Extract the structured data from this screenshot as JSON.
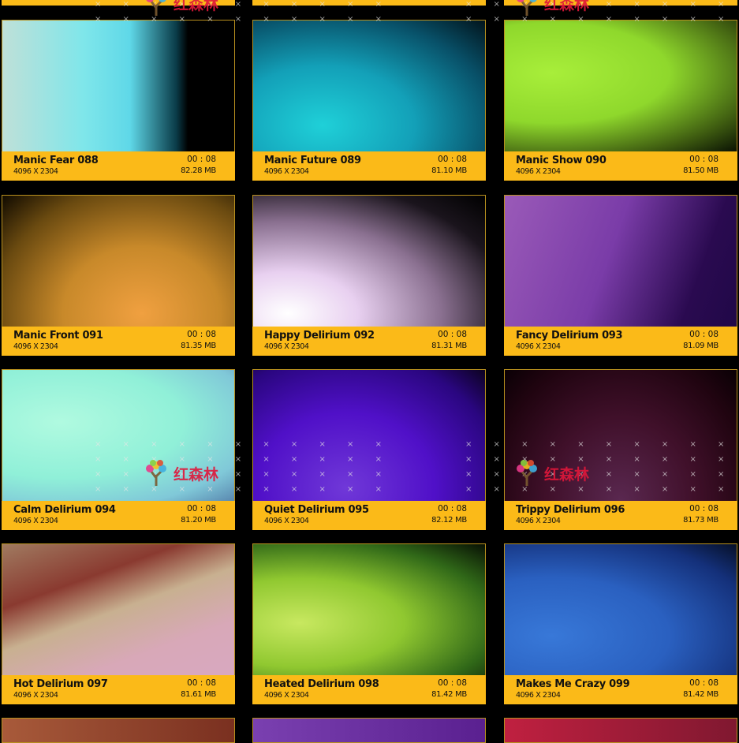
{
  "watermark": "红森林",
  "top_partial": [
    {
      "color": "#fbba18"
    },
    {
      "color": "#fbba18"
    },
    {
      "color": "#fbba18"
    }
  ],
  "cards": [
    {
      "title": "Manic Fear 088",
      "resolution": "4096 X 2304",
      "duration": "00 : 08",
      "size": "82.28 MB",
      "gradient": "linear-gradient(90deg,#bfe0d8 0%,#7fe6ea 35%,#5fd8e8 55%,#0a3b48 75%,#000 80%)"
    },
    {
      "title": "Manic Future 089",
      "resolution": "4096 X 2304",
      "duration": "00 : 08",
      "size": "81.10 MB",
      "gradient": "radial-gradient(ellipse at 30% 80%,#1fd0d8 0%,#13a0b8 40%,#085068 75%,#02141c 100%)"
    },
    {
      "title": "Manic Show 090",
      "resolution": "4096 X 2304",
      "duration": "00 : 08",
      "size": "81.50 MB",
      "gradient": "radial-gradient(ellipse at 20% 40%,#a8ee3a 0%,#8fd82c 45%,#3d5a10 80%,#0a1204 100%)"
    },
    {
      "title": "Manic Front 091",
      "resolution": "4096 X 2304",
      "duration": "00 : 08",
      "size": "81.35 MB",
      "gradient": "radial-gradient(ellipse at 60% 90%,#f0a040 0%,#c8892a 40%,#6a4a10 75%,#100a00 100%)"
    },
    {
      "title": "Happy Delirium 092",
      "resolution": "4096 X 2304",
      "duration": "00 : 08",
      "size": "81.31 MB",
      "gradient": "radial-gradient(ellipse at 15% 90%,#ffffff 0%,#e8d0f0 25%,#8a7090 55%,#1a141c 80%,#000 100%)"
    },
    {
      "title": "Fancy Delirium 093",
      "resolution": "4096 X 2304",
      "duration": "00 : 08",
      "size": "81.09 MB",
      "gradient": "linear-gradient(110deg,#9a5ab8 0%,#7a3ca8 45%,#2a0a50 80%,#200848 100%)"
    },
    {
      "title": "Calm Delirium 094",
      "resolution": "4096 X 2304",
      "duration": "00 : 08",
      "size": "81.20 MB",
      "gradient": "radial-gradient(ellipse at 25% 40%,#b0fae0 0%,#90f0d8 50%,#80c8d8 80%,#5a88b0 100%)"
    },
    {
      "title": "Quiet Delirium 095",
      "resolution": "4096 X 2304",
      "duration": "00 : 08",
      "size": "82.12 MB",
      "gradient": "radial-gradient(ellipse at 40% 90%,#7038d8 0%,#5010c8 45%,#2a0680 80%,#0c0220 100%)"
    },
    {
      "title": "Trippy Delirium 096",
      "resolution": "4096 X 2304",
      "duration": "00 : 08",
      "size": "81.73 MB",
      "gradient": "radial-gradient(ellipse at 50% 100%,#5a2850 0%,#40102a 45%,#200410 80%,#0a0005 100%)"
    },
    {
      "title": "Hot Delirium 097",
      "resolution": "4096 X 2304",
      "duration": "00 : 08",
      "size": "81.61 MB",
      "gradient": "linear-gradient(160deg,#a07a60 0%,#8a3a30 30%,#c8b090 50%,#d8a8b8 75%,#d8a8c0 100%)"
    },
    {
      "title": "Heated Delirium 098",
      "resolution": "4096 X 2304",
      "duration": "00 : 08",
      "size": "81.42 MB",
      "gradient": "radial-gradient(ellipse at 20% 60%,#c8e860 0%,#90c830 40%,#306818 75%,#081004 100%)"
    },
    {
      "title": "Makes Me Crazy 099",
      "resolution": "4096 X 2304",
      "duration": "00 : 08",
      "size": "81.42 MB",
      "gradient": "radial-gradient(ellipse at 20% 70%,#3878d8 0%,#2a60c0 45%,#14307a 80%,#061028 100%)"
    }
  ],
  "bottom_partial": [
    {
      "gradient": "linear-gradient(90deg,#a85a3a,#7a3020)"
    },
    {
      "gradient": "linear-gradient(90deg,#7a40b0,#5a2090)"
    },
    {
      "gradient": "linear-gradient(90deg,#c02040,#801830)"
    }
  ]
}
